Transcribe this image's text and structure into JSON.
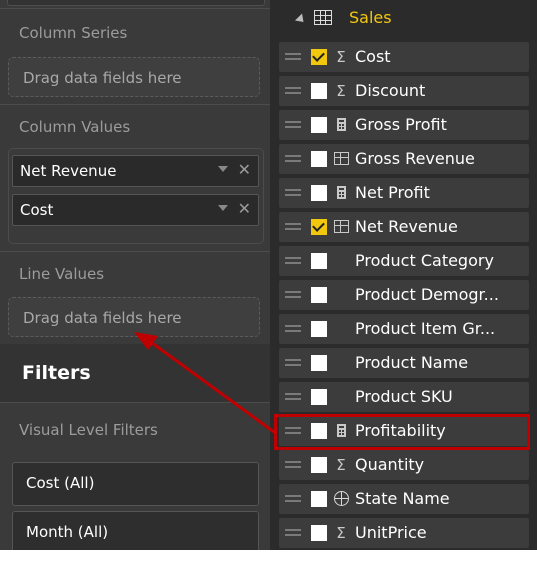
{
  "left_panel": {
    "column_series": {
      "label": "Column Series",
      "placeholder": "Drag data fields here"
    },
    "column_values": {
      "label": "Column Values",
      "items": [
        {
          "label": "Net Revenue"
        },
        {
          "label": "Cost"
        }
      ]
    },
    "line_values": {
      "label": "Line Values",
      "placeholder": "Drag data fields here"
    },
    "filters": {
      "title": "Filters",
      "visual_level_label": "Visual Level Filters",
      "items": [
        {
          "label": "Cost (All)"
        },
        {
          "label": "Month (All)"
        }
      ]
    }
  },
  "fields_pane": {
    "table_name": "Sales",
    "fields": [
      {
        "name": "Cost",
        "checked": true,
        "icon": "sigma-icon"
      },
      {
        "name": "Discount",
        "checked": false,
        "icon": "sigma-icon"
      },
      {
        "name": "Gross Profit",
        "checked": false,
        "icon": "calculator-icon"
      },
      {
        "name": "Gross Revenue",
        "checked": false,
        "icon": "table-calc-icon"
      },
      {
        "name": "Net Profit",
        "checked": false,
        "icon": "calculator-icon"
      },
      {
        "name": "Net Revenue",
        "checked": true,
        "icon": "table-calc-icon"
      },
      {
        "name": "Product Category",
        "checked": false,
        "icon": "none"
      },
      {
        "name": "Product Demogr...",
        "checked": false,
        "icon": "none"
      },
      {
        "name": "Product Item Gr...",
        "checked": false,
        "icon": "none"
      },
      {
        "name": "Product Name",
        "checked": false,
        "icon": "none"
      },
      {
        "name": "Product SKU",
        "checked": false,
        "icon": "none"
      },
      {
        "name": "Profitability",
        "checked": false,
        "icon": "calculator-icon"
      },
      {
        "name": "Quantity",
        "checked": false,
        "icon": "sigma-icon"
      },
      {
        "name": "State Name",
        "checked": false,
        "icon": "globe-icon"
      },
      {
        "name": "UnitPrice",
        "checked": false,
        "icon": "sigma-icon"
      }
    ]
  },
  "colors": {
    "accent": "#f2c80f",
    "highlight": "#c00000",
    "panel_bg": "#3a3a3a",
    "fields_bg": "#2b2b2b"
  }
}
